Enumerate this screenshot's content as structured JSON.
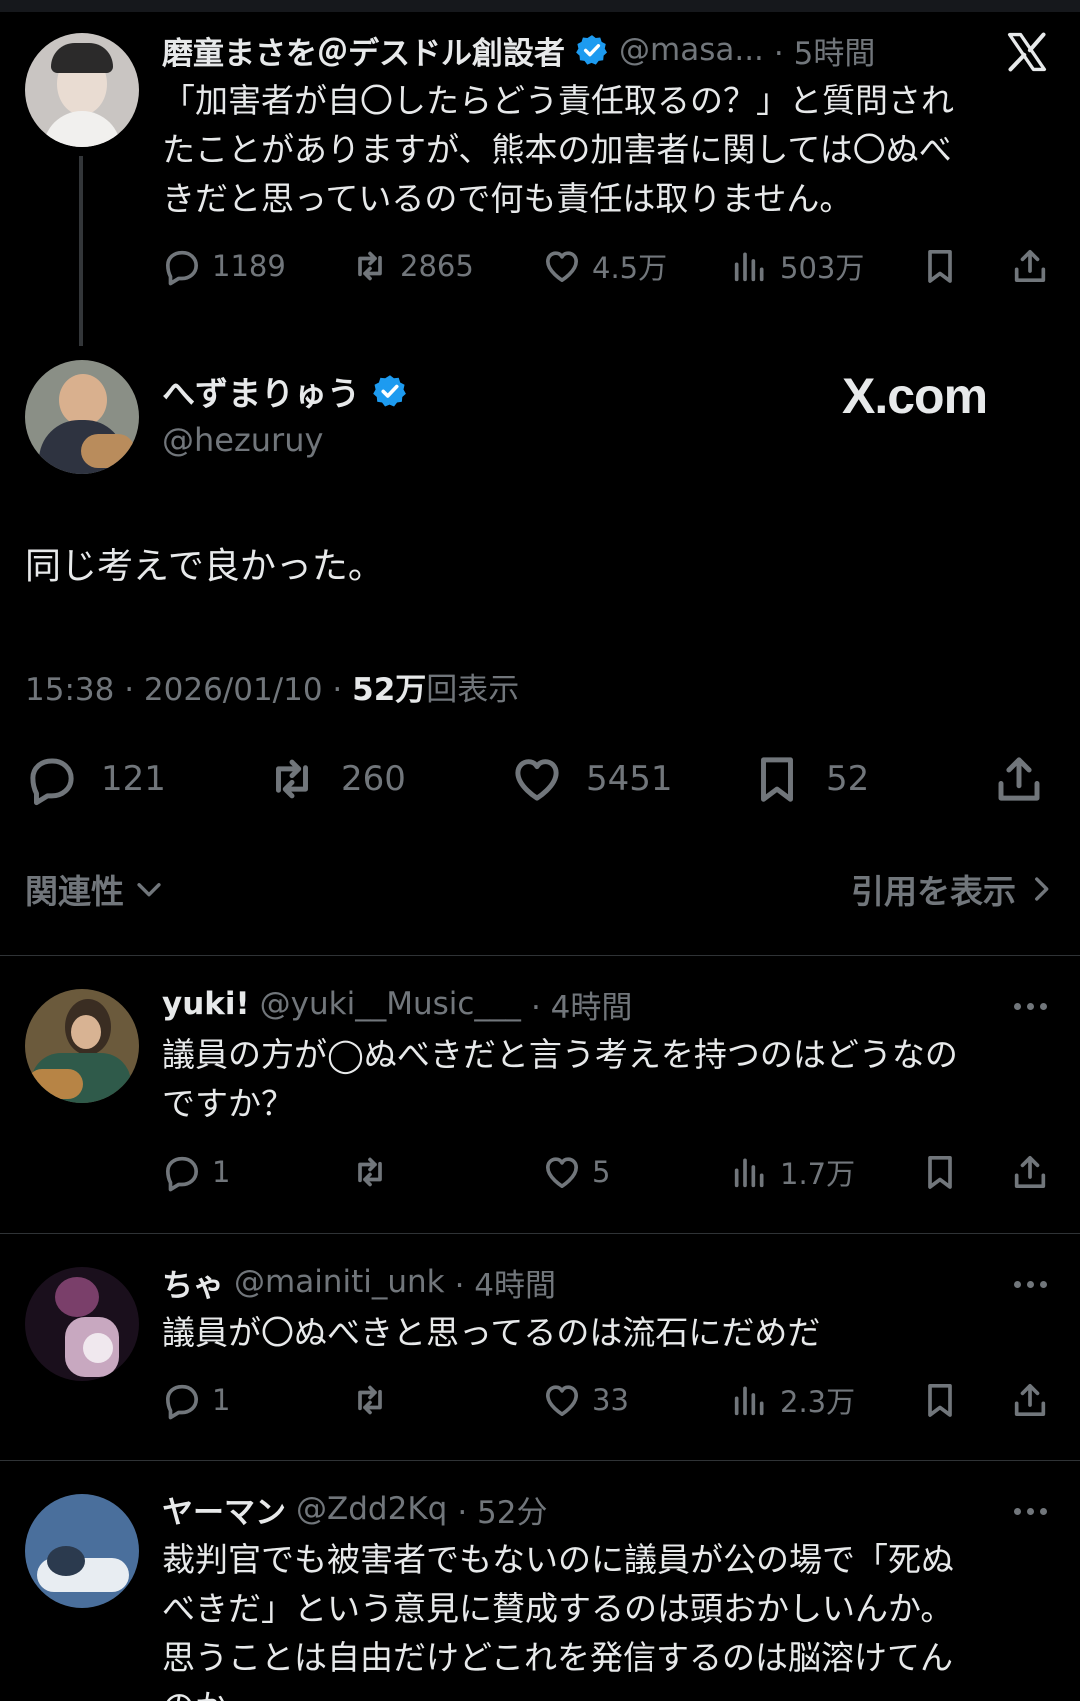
{
  "brand": {
    "x_logo": "x-logo-icon",
    "watermark": "X.com"
  },
  "quoted": {
    "name": "磨童まさを＠デスドル創設者",
    "handle": "@masa...",
    "time": "· 5時間",
    "text_lines": [
      "「加害者が自〇したらどう責任取るの？」と質問され",
      "たことがありますが、熊本の加害者に関しては〇ぬべ",
      "きだと思っているので何も責任は取りません。"
    ],
    "stats": {
      "replies": "1189",
      "reposts": "2865",
      "likes": "4.5万",
      "views": "503万"
    }
  },
  "main": {
    "name": "へずまりゅう",
    "handle": "@hezuruy",
    "text": "同じ考えで良かった。",
    "meta_time": "15:38 · 2026/01/10 · ",
    "meta_views_count": "52万",
    "meta_views_label": "回表示",
    "stats": {
      "replies": "121",
      "reposts": "260",
      "likes": "5451",
      "bookmarks": "52"
    }
  },
  "sort": {
    "label": "関連性",
    "quotes_label": "引用を表示"
  },
  "replies": [
    {
      "name": "yuki!",
      "handle": "@yuki__Music___",
      "time": "· 4時間",
      "text_lines": [
        "議員の方が◯ぬべきだと言う考えを持つのはどうなの",
        "ですか？"
      ],
      "stats": {
        "replies": "1",
        "reposts": "",
        "likes": "5",
        "views": "1.7万"
      }
    },
    {
      "name": "ちゃ",
      "handle": "@mainiti_unk",
      "time": "· 4時間",
      "text_lines": [
        "議員が〇ぬべきと思ってるのは流石にだめだ"
      ],
      "stats": {
        "replies": "1",
        "reposts": "",
        "likes": "33",
        "views": "2.3万"
      }
    },
    {
      "name": "ヤーマン",
      "handle": "@Zdd2Kq",
      "time": "· 52分",
      "text_lines": [
        "裁判官でも被害者でもないのに議員が公の場で「死ぬ",
        "べきだ」という意見に賛成するのは頭おかしいんか。",
        "思うことは自由だけどこれを発信するのは脳溶けてん",
        "のか"
      ]
    }
  ],
  "colors": {
    "bg": "#000000",
    "text": "#e7e9ea",
    "muted": "#71767b",
    "verified": "#1d9bf0",
    "divider": "#2f3336"
  }
}
